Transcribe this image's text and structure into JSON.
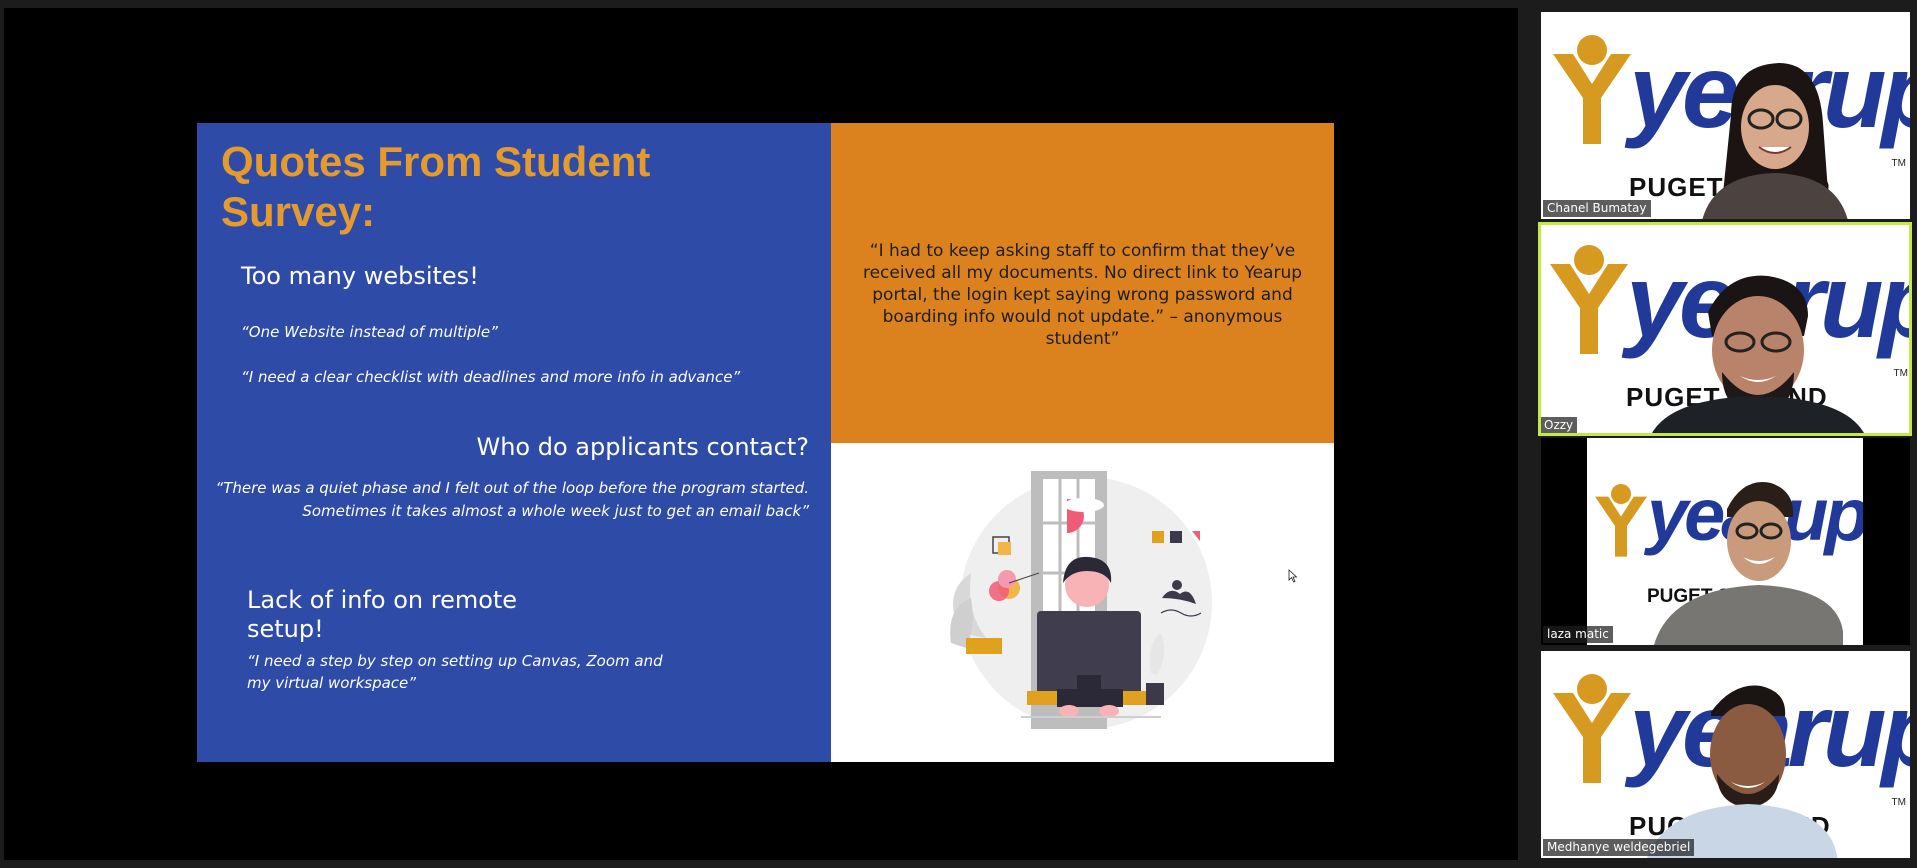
{
  "slide": {
    "title": "Quotes From Student Survey:",
    "section1": {
      "heading": "Too many websites!",
      "quotes": [
        "“One Website instead of multiple”",
        "“I need a clear checklist with deadlines and more info in advance”"
      ]
    },
    "section2": {
      "heading": "Who do applicants contact?",
      "quote_line1": "“There was a quiet phase and I felt out of the loop before the program started.",
      "quote_line2": "Sometimes it takes almost a whole week just to get an email back”"
    },
    "section3": {
      "heading": "Lack of info on remote setup!",
      "quote": "“I need a step by step on setting up Canvas, Zoom and my virtual workspace”"
    },
    "featured_quote": "“I had to keep asking staff to confirm that they’ve received all my documents. No direct link to Yearup portal, the login kept saying wrong password and boarding info would not update.” – anonymous student”"
  },
  "participants": [
    {
      "name": "Chanel Bumatay",
      "active": false
    },
    {
      "name": "Ozzy",
      "active": true
    },
    {
      "name": "laza matic",
      "active": false
    },
    {
      "name": "Medhanye weldegebriel",
      "active": false
    }
  ],
  "logo": {
    "text": "yearup",
    "subtext": "PUGET SOUND",
    "tm": "TM"
  },
  "colors": {
    "slide_blue": "#2e4ba8",
    "slide_orange": "#db821f",
    "title_orange": "#e49a2c",
    "logo_blue": "#213a99",
    "logo_gold": "#d79a20",
    "active_speaker": "#c2e84a"
  }
}
